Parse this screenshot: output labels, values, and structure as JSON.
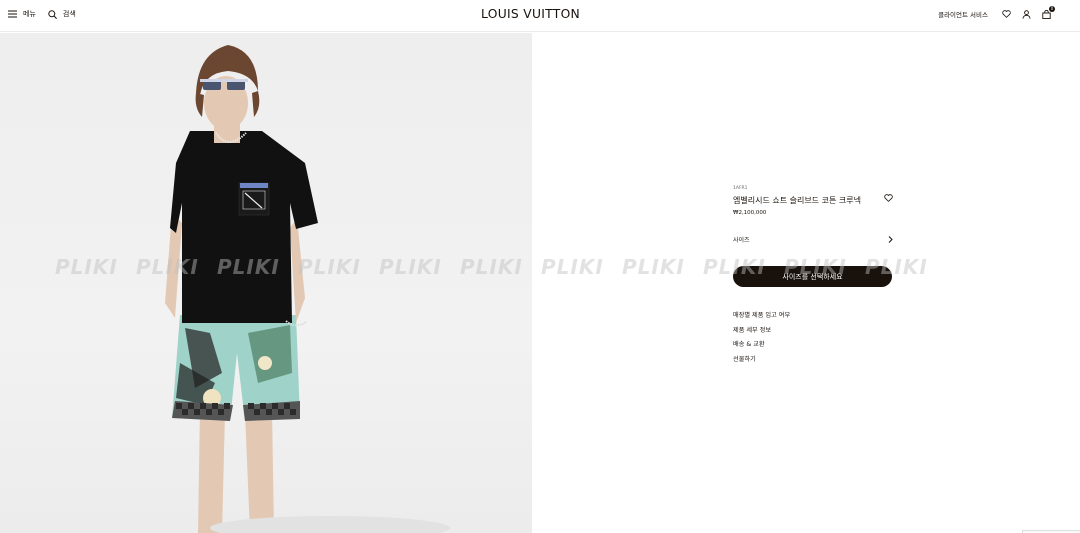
{
  "header": {
    "menu_label": "메뉴",
    "search_label": "검색",
    "logo": "LOUIS VUITTON",
    "client_service": "클라이언트 서비스",
    "cart_count": "0"
  },
  "watermark": {
    "items": [
      "PLIKI",
      "PLIKI",
      "PLIKI",
      "PLIKI",
      "PLIKI",
      "PLIKI",
      "PLIKI",
      "PLIKI",
      "PLIKI",
      "PLIKI",
      "PLIKI"
    ]
  },
  "product": {
    "ref": "1AFR1",
    "name": "엠벨리시드 쇼트 슬리브드 코튼 크루넥",
    "price": "₩2,100,000",
    "size_label": "사이즈",
    "cta": "사이즈를 선택하세요"
  },
  "links": [
    "매장별 제품 입고 여부",
    "제품 세부 정보",
    "배송 & 교환",
    "선물하기"
  ],
  "colors": {
    "text": "#19110b",
    "cta_bg": "#19110b",
    "photo_bg": "#efefef"
  }
}
